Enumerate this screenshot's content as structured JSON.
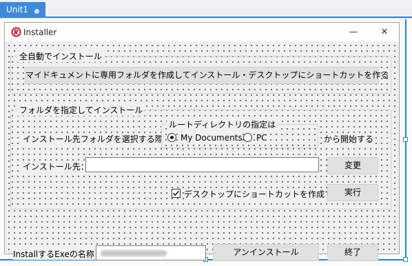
{
  "ide": {
    "tab_label": "Unit1"
  },
  "window": {
    "title": "Installer",
    "minimize_glyph": "—",
    "close_glyph": "✕"
  },
  "auto_group": {
    "title": "全自動でインストール",
    "install_button": "マイドキュメントに専用フォルダを作成してインストール・デスクトップにショートカットを作る"
  },
  "folder_group": {
    "title": "フォルダを指定してインストール",
    "select_label_prefix": "インストール先フォルダを選択する際の",
    "select_label_suffix": "から開始する",
    "root_group": {
      "title": "ルートディレクトリの指定は",
      "options": [
        {
          "label": "My Documents",
          "selected": true
        },
        {
          "label": "PC",
          "selected": false
        }
      ]
    },
    "dest_label": "インストール先：",
    "dest_value": "",
    "change_button": "変更",
    "shortcut_label": "デスクトップにショートカットを作成する",
    "shortcut_checked": true,
    "run_button": "実行"
  },
  "footer": {
    "exe_label": "InstallするExeの名称：",
    "uninstall_button": "アンインストール",
    "exit_button": "終了"
  }
}
